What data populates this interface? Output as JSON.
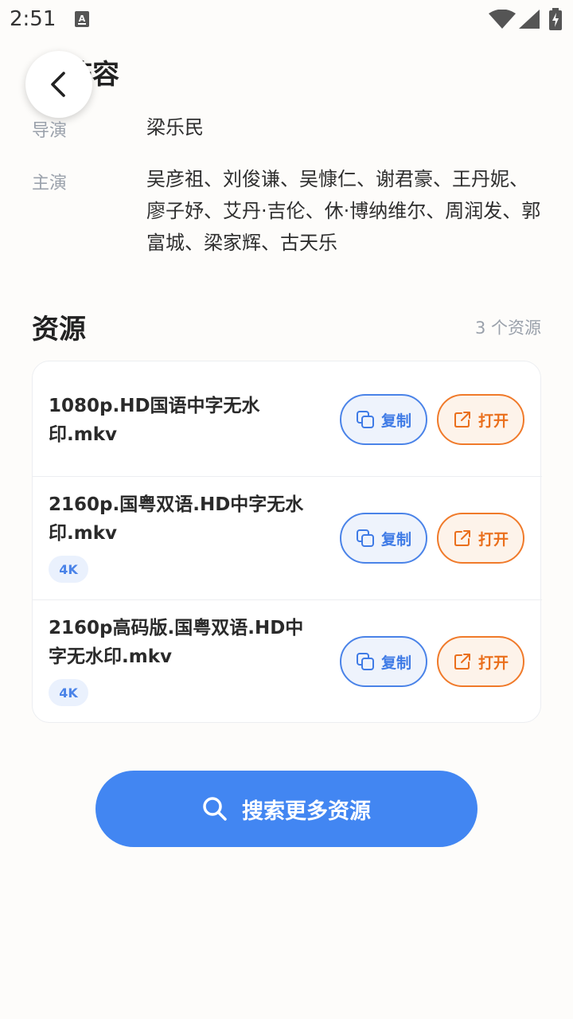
{
  "status_bar": {
    "time": "2:51"
  },
  "header": {
    "section_title": "阵容"
  },
  "credits": {
    "director_label": "导演",
    "director_value": "梁乐民",
    "cast_label": "主演",
    "cast_value": "吴彦祖、刘俊谦、吴慷仁、谢君豪、王丹妮、廖子妤、艾丹·吉伦、休·博纳维尔、周润发、郭富城、梁家辉、古天乐"
  },
  "resources": {
    "title": "资源",
    "count": "3 个资源",
    "copy_label": "复制",
    "open_label": "打开",
    "items": [
      {
        "name": "1080p.HD国语中字无水印.mkv",
        "badge": ""
      },
      {
        "name": "2160p.国粤双语.HD中字无水印.mkv",
        "badge": "4K"
      },
      {
        "name": "2160p高码版.国粤双语.HD中字无水印.mkv",
        "badge": "4K"
      }
    ]
  },
  "search_button": {
    "label": "搜索更多资源"
  },
  "colors": {
    "accent_blue": "#4286f2",
    "accent_orange": "#f07a2a",
    "background": "#fdfcfa"
  }
}
